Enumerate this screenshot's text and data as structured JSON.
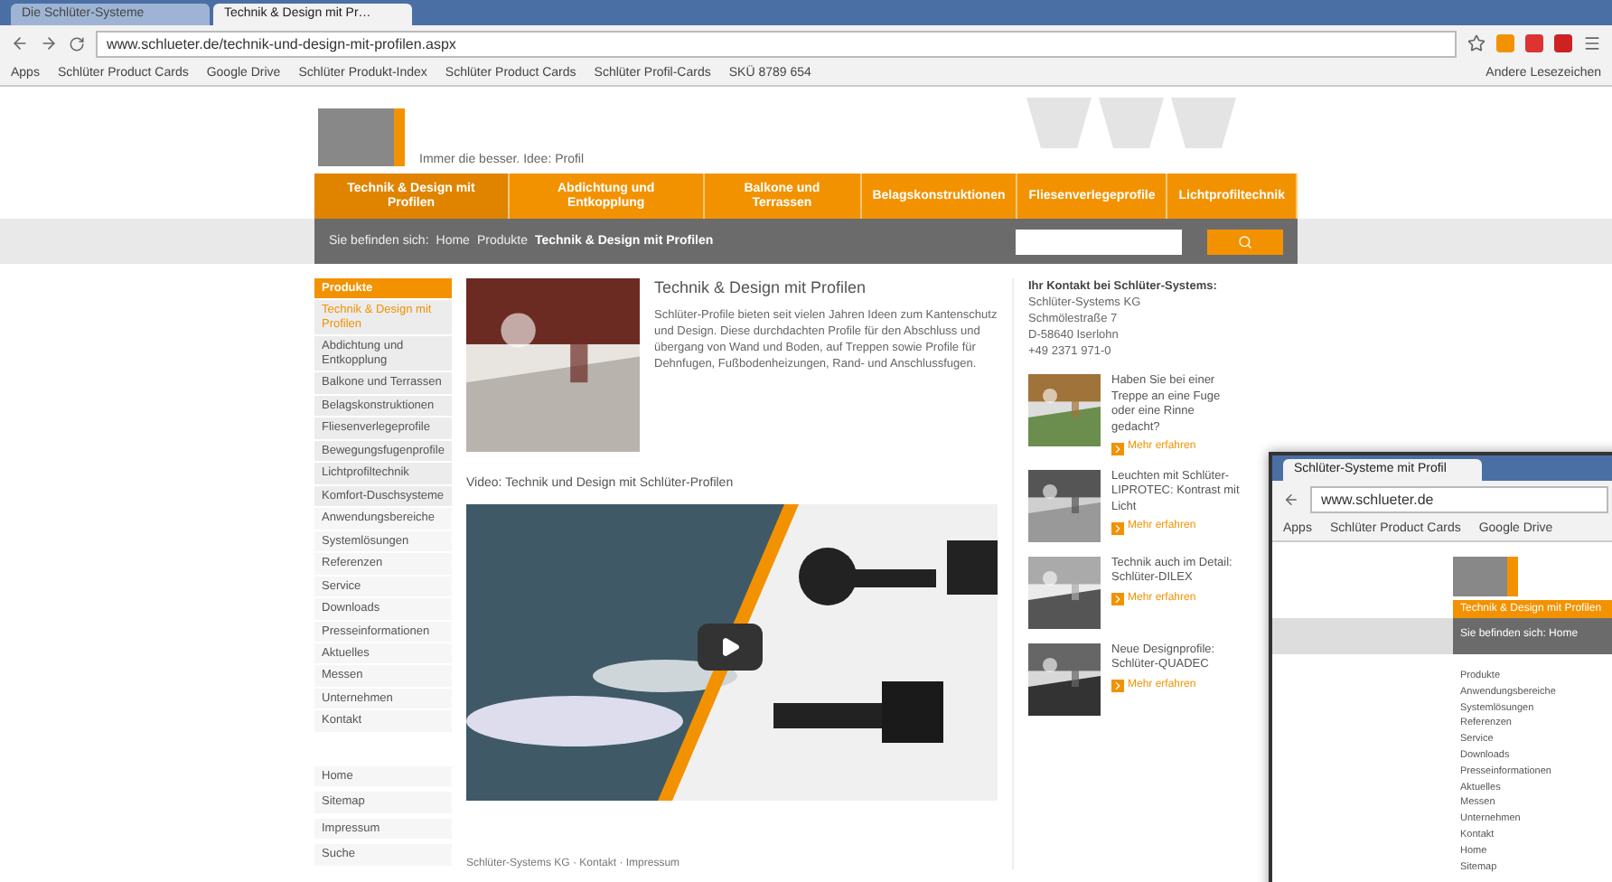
{
  "browser": {
    "tabs": [
      {
        "title": "Die Schlüter-Systeme",
        "selected": false
      },
      {
        "title": "Technik & Design mit Pr…",
        "selected": true
      }
    ],
    "url": "www.schlueter.de/technik-und-design-mit-profilen.aspx",
    "bookmarks": [
      "Apps",
      "Schlüter Product Cards",
      "Google Drive",
      "Schlüter Produkt-Index",
      "Schlüter Product Cards",
      "Schlüter Profil-Cards",
      "SKÜ 8789 654"
    ],
    "other_bookmarks": "Andere Lesezeichen"
  },
  "site": {
    "tagline": "Immer die besser. Idee: Profil",
    "nav": [
      {
        "label": "Technik & Design mit Profilen",
        "selected": true
      },
      {
        "label": "Abdichtung und Entkopplung",
        "selected": false
      },
      {
        "label": "Balkone und Terrassen",
        "selected": false
      },
      {
        "label": "Belagskonstruktionen",
        "selected": false
      },
      {
        "label": "Fliesenverlegeprofile",
        "selected": false
      },
      {
        "label": "Lichtprofiltechnik",
        "selected": false
      }
    ],
    "breadcrumb": [
      "Sie befinden sich:",
      "Home",
      "Produkte"
    ],
    "breadcrumb_current": "Technik & Design mit Profilen",
    "sidebar": [
      {
        "label": "Produkte",
        "kind": "heading",
        "selected": false
      },
      {
        "label": "Technik & Design mit Profilen",
        "kind": "item",
        "selected": true
      },
      {
        "label": "Abdichtung und Entkopplung",
        "kind": "item",
        "selected": false
      },
      {
        "label": "Balkone und Terrassen",
        "kind": "item",
        "selected": false
      },
      {
        "label": "Belagskonstruktionen",
        "kind": "item",
        "selected": false
      },
      {
        "label": "Fliesenverlegeprofile",
        "kind": "item",
        "selected": false
      },
      {
        "label": "Bewegungsfugenprofile",
        "kind": "item",
        "selected": false
      },
      {
        "label": "Lichtprofiltechnik",
        "kind": "item",
        "selected": false
      },
      {
        "label": "Komfort-Duschsysteme",
        "kind": "item",
        "selected": false
      },
      {
        "label": "Anwendungsbereiche",
        "kind": "link",
        "selected": false
      },
      {
        "label": "Systemlösungen",
        "kind": "link",
        "selected": false
      },
      {
        "label": "Referenzen",
        "kind": "link",
        "selected": false
      },
      {
        "label": "Service",
        "kind": "link",
        "selected": false
      },
      {
        "label": "Downloads",
        "kind": "link",
        "selected": false
      },
      {
        "label": "Presseinformationen",
        "kind": "link",
        "selected": false
      },
      {
        "label": "Aktuelles",
        "kind": "link",
        "selected": false
      },
      {
        "label": "Messen",
        "kind": "link",
        "selected": false
      },
      {
        "label": "Unternehmen",
        "kind": "link",
        "selected": false
      },
      {
        "label": "Kontakt",
        "kind": "link",
        "selected": false
      },
      {
        "label": "Home",
        "kind": "footer",
        "selected": false
      },
      {
        "label": "Sitemap",
        "kind": "footer",
        "selected": false
      },
      {
        "label": "Impressum",
        "kind": "footer",
        "selected": false
      },
      {
        "label": "Suche",
        "kind": "footer",
        "selected": false
      }
    ],
    "intro_title": "Technik & Design mit Profilen",
    "intro_text": "Schlüter-Profile bieten seit vielen Jahren Ideen zum Kantenschutz und Design. Diese durchdachten Profile für den Abschluss und übergang von Wand und Boden, auf Treppen sowie Profile für Dehnfugen, Fußbodenheizungen, Rand- und Anschlussfugen.",
    "video_title": "Video: Technik und Design mit Schlüter-Profilen",
    "footer_note": "Schlüter-Systems KG · Kontakt · Impressum",
    "contact": [
      "Ihr Kontakt bei Schlüter-Systems:",
      "Schlüter-Systems KG",
      "Schmölestraße 7",
      "D-58640 Iserlohn",
      "+49 2371 971-0"
    ],
    "teasers": [
      {
        "title": "Haben Sie bei einer Treppe an eine Fuge oder eine Rinne gedacht?",
        "link": "Mehr erfahren"
      },
      {
        "title": "Leuchten mit Schlüter-LIPROTEC: Kontrast mit Licht",
        "link": "Mehr erfahren"
      },
      {
        "title": "Technik auch im Detail: Schlüter-DILEX",
        "link": "Mehr erfahren"
      },
      {
        "title": "Neue Designprofile: Schlüter-QUADEC",
        "link": "Mehr erfahren"
      }
    ]
  },
  "second_window": {
    "tab": "Schlüter-Systeme mit Profil",
    "url": "www.schlueter.de",
    "bookmarks": [
      "Apps",
      "Schlüter Product Cards",
      "Google Drive"
    ],
    "nav_item": "Technik & Design mit Profilen",
    "breadcrumb": "Sie befinden sich: Home",
    "sidebar": [
      "Produkte",
      "Anwendungsbereiche",
      "Systemlösungen",
      "Referenzen",
      "Service",
      "Downloads",
      "Presseinformationen",
      "Aktuelles",
      "Messen",
      "Unternehmen",
      "Kontakt",
      "Home",
      "Sitemap"
    ]
  }
}
